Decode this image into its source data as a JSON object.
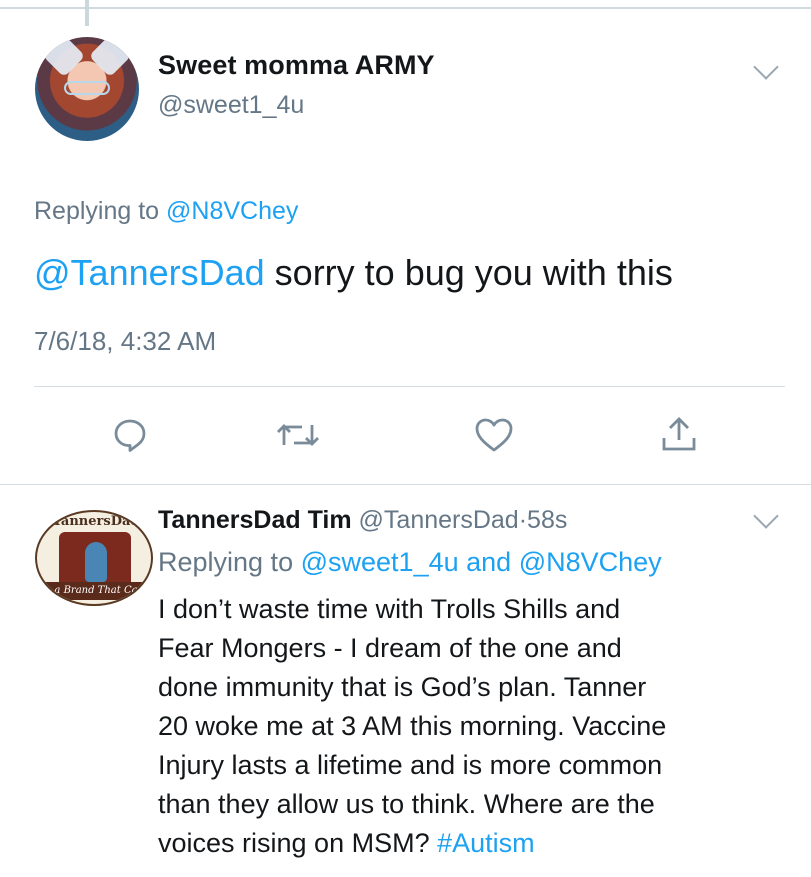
{
  "tweet": {
    "author_name": "Sweet momma ARMY",
    "author_handle": "@sweet1_4u",
    "replying_prefix": "Replying to",
    "replying_handle": "@N8VChey",
    "mention": "@TannersDad",
    "text": " sorry to bug you with this",
    "timestamp": "7/6/18, 4:32 AM",
    "actions": [
      "reply-icon",
      "retweet-icon",
      "like-icon",
      "share-icon"
    ]
  },
  "reply": {
    "author_name": "TannersDad Tim",
    "author_handle": "@TannersDad",
    "separator": "·",
    "time": "58s",
    "replying_prefix": "Replying to",
    "replying_handle_1": "@sweet1_4u",
    "replying_and": "and",
    "replying_handle_2": "@N8VChey",
    "lines": [
      "I don’t waste time with Trolls Shills and",
      "Fear Mongers - I dream of the one and",
      "done immunity that is God’s plan. Tanner",
      "20 woke me at 3 AM this morning. Vaccine",
      "Injury lasts a lifetime and is more common",
      "than they allow us to think. Where are the",
      "voices rising on MSM? "
    ],
    "hashtag": "#Autism",
    "avatar_text_top": "TannersDad",
    "avatar_banner": "a Brand That Ca"
  },
  "colors": {
    "link": "#1da1f2",
    "muted": "#657786",
    "text": "#14171a"
  }
}
